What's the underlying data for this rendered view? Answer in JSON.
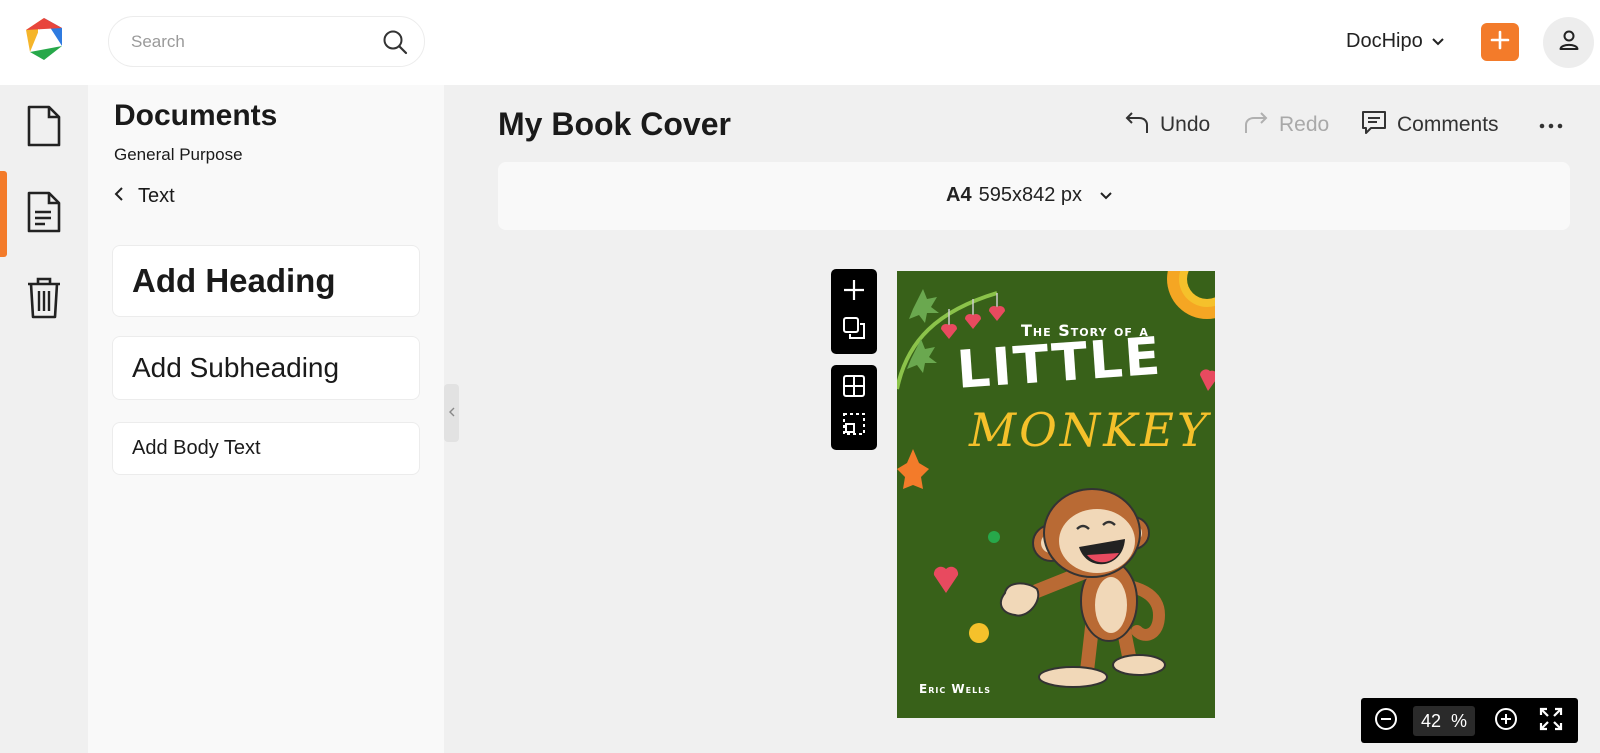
{
  "topbar": {
    "search_placeholder": "Search",
    "account_name": "DocHipo"
  },
  "panel": {
    "title": "Documents",
    "subtitle": "General Purpose",
    "back_label": "Text",
    "cards": {
      "heading": "Add Heading",
      "subheading": "Add Subheading",
      "body": "Add Body Text"
    }
  },
  "editor": {
    "doc_title": "My Book Cover",
    "undo_label": "Undo",
    "redo_label": "Redo",
    "comments_label": "Comments",
    "page_size_name": "A4",
    "page_size_dims": "595x842 px"
  },
  "cover": {
    "line1": "The Story of a",
    "line2": "LITTLE",
    "line3": "MONKEY",
    "author": "Eric Wells"
  },
  "zoom": {
    "value": "42",
    "unit": "%"
  },
  "colors": {
    "accent": "#f37b2a",
    "cover_green": "#386119",
    "cover_yellow": "#f5c12b"
  }
}
